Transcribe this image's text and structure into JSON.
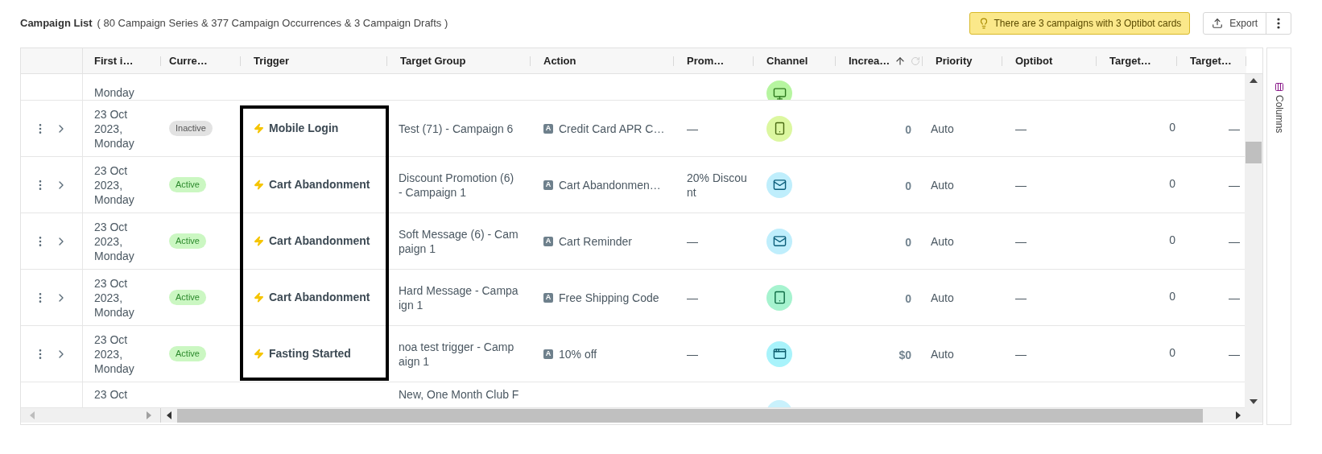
{
  "header": {
    "title": "Campaign List",
    "subtitle": "( 80 Campaign Series & 377 Campaign Occurrences & 3 Campaign Drafts )",
    "notice": "There are 3 campaigns with 3 Optibot cards",
    "export_button": "Export"
  },
  "table": {
    "columns": [
      {
        "label": "First i…"
      },
      {
        "label": "Curre…"
      },
      {
        "label": "Trigger"
      },
      {
        "label": "Target Group"
      },
      {
        "label": "Action"
      },
      {
        "label": "Prom…"
      },
      {
        "label": "Channel"
      },
      {
        "label": "Increa…",
        "sorted_ascending": true
      },
      {
        "label": "Priority"
      },
      {
        "label": "Optibot"
      },
      {
        "label": "Target…"
      },
      {
        "label": "Target…"
      }
    ],
    "rows": [
      {
        "kind": "cut_top",
        "date": "Monday",
        "channel": {
          "kind": "desktop"
        }
      },
      {
        "kind": "full",
        "date": "23 Oct 2023, Monday",
        "status": {
          "label": "Inactive",
          "active": false
        },
        "trigger": "Mobile Login",
        "target_group": "Test (71) - Campaign 6",
        "action_badge": "A",
        "action": "Credit Card APR C…",
        "promotion": "—",
        "channel": {
          "kind": "mobile"
        },
        "increase": "0",
        "priority": "Auto",
        "optibot": "—",
        "target_a": "0",
        "target_b": "—"
      },
      {
        "kind": "full",
        "date": "23 Oct 2023, Monday",
        "status": {
          "label": "Active",
          "active": true
        },
        "trigger": "Cart Abandonment",
        "target_group": "Discount Promotion (6) - Campaign 1",
        "action_badge": "A",
        "action": "Cart Abandonmen…",
        "promotion": "20% Discount",
        "channel": {
          "kind": "email"
        },
        "increase": "0",
        "priority": "Auto",
        "optibot": "—",
        "target_a": "0",
        "target_b": "—"
      },
      {
        "kind": "full",
        "date": "23 Oct 2023, Monday",
        "status": {
          "label": "Active",
          "active": true
        },
        "trigger": "Cart Abandonment",
        "target_group": "Soft Message (6) - Campaign 1",
        "action_badge": "A",
        "action": "Cart Reminder",
        "promotion": "—",
        "channel": {
          "kind": "email"
        },
        "increase": "0",
        "priority": "Auto",
        "optibot": "—",
        "target_a": "0",
        "target_b": "—"
      },
      {
        "kind": "full",
        "date": "23 Oct 2023, Monday",
        "status": {
          "label": "Active",
          "active": true
        },
        "trigger": "Cart Abandonment",
        "target_group": "Hard Message - Campaign 1",
        "action_badge": "A",
        "action": "Free Shipping Code",
        "promotion": "—",
        "channel": {
          "kind": "tablet"
        },
        "increase": "0",
        "priority": "Auto",
        "optibot": "—",
        "target_a": "0",
        "target_b": "—"
      },
      {
        "kind": "full",
        "date": "23 Oct 2023, Monday",
        "status": {
          "label": "Active",
          "active": true
        },
        "trigger": "Fasting Started",
        "target_group": "noa test trigger - Campaign 1",
        "action_badge": "A",
        "action": "10% off",
        "promotion": "—",
        "channel": {
          "kind": "api"
        },
        "increase": "$0",
        "priority": "Auto",
        "optibot": "—",
        "target_a": "0",
        "target_b": "—"
      },
      {
        "kind": "cut_bottom",
        "date": "23 Oct",
        "target_group": "New, One Month Club F",
        "channel": {
          "kind": "email_light"
        }
      }
    ]
  },
  "columns_panel": {
    "label": "Columns"
  }
}
